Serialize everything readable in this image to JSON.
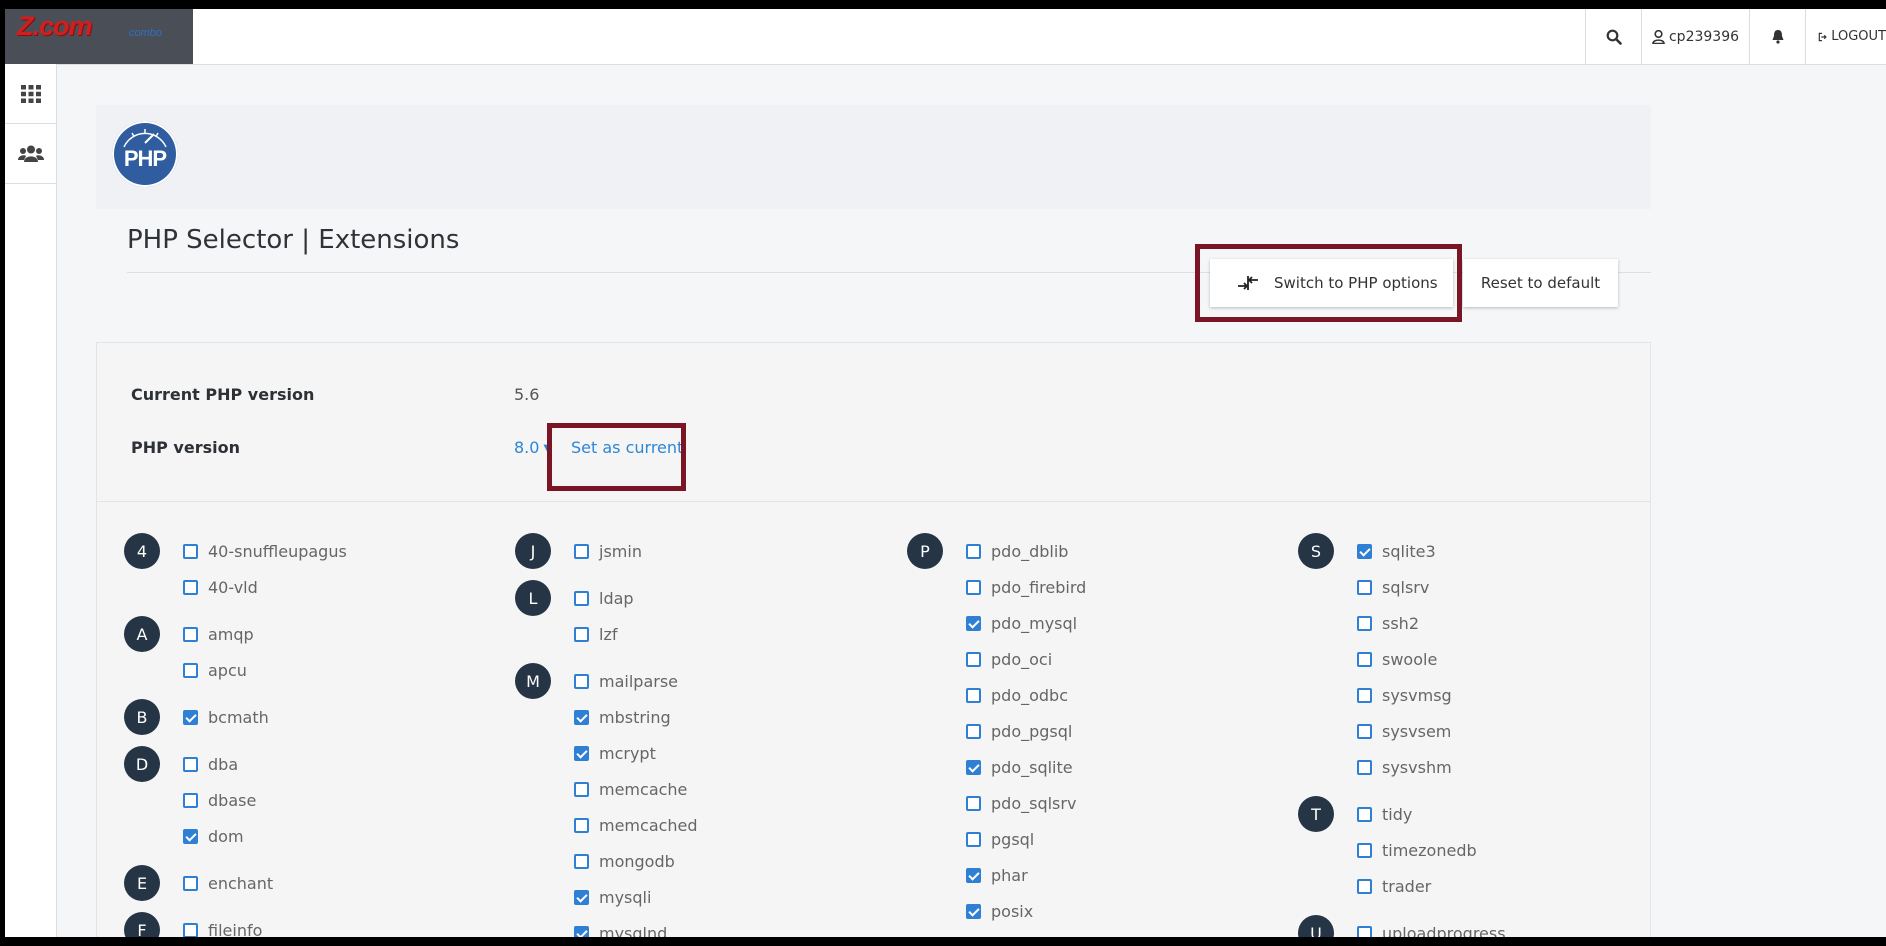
{
  "header": {
    "logo_brand": "Z.com",
    "logo_sub": "combo",
    "username": "cp239396",
    "logout_label": "LOGOUT"
  },
  "rail": {
    "icons": [
      "grid-icon",
      "users-icon"
    ]
  },
  "page": {
    "title": "PHP Selector | Extensions",
    "logo_text": "PHP",
    "switch_label": "Switch to PHP options",
    "reset_label": "Reset to default"
  },
  "version": {
    "current_label": "Current PHP version",
    "current_value": "5.6",
    "php_label": "PHP version",
    "php_value": "8.0",
    "set_current_label": "Set as current"
  },
  "columns": [
    {
      "groups": [
        {
          "letter": "4",
          "items": [
            {
              "name": "40-snuffleupagus",
              "checked": false
            },
            {
              "name": "40-vld",
              "checked": false
            }
          ]
        },
        {
          "letter": "A",
          "items": [
            {
              "name": "amqp",
              "checked": false
            },
            {
              "name": "apcu",
              "checked": false
            }
          ]
        },
        {
          "letter": "B",
          "items": [
            {
              "name": "bcmath",
              "checked": true
            }
          ]
        },
        {
          "letter": "D",
          "items": [
            {
              "name": "dba",
              "checked": false
            },
            {
              "name": "dbase",
              "checked": false
            },
            {
              "name": "dom",
              "checked": true
            }
          ]
        },
        {
          "letter": "E",
          "items": [
            {
              "name": "enchant",
              "checked": false
            }
          ]
        },
        {
          "letter": "F",
          "items": [
            {
              "name": "fileinfo",
              "checked": false
            }
          ]
        }
      ]
    },
    {
      "groups": [
        {
          "letter": "J",
          "items": [
            {
              "name": "jsmin",
              "checked": false
            }
          ]
        },
        {
          "letter": "L",
          "items": [
            {
              "name": "ldap",
              "checked": false
            },
            {
              "name": "lzf",
              "checked": false
            }
          ]
        },
        {
          "letter": "M",
          "items": [
            {
              "name": "mailparse",
              "checked": false
            },
            {
              "name": "mbstring",
              "checked": true
            },
            {
              "name": "mcrypt",
              "checked": true
            },
            {
              "name": "memcache",
              "checked": false
            },
            {
              "name": "memcached",
              "checked": false
            },
            {
              "name": "mongodb",
              "checked": false
            },
            {
              "name": "mysqli",
              "checked": true
            },
            {
              "name": "mysqlnd",
              "checked": true
            }
          ]
        }
      ]
    },
    {
      "groups": [
        {
          "letter": "P",
          "items": [
            {
              "name": "pdo_dblib",
              "checked": false
            },
            {
              "name": "pdo_firebird",
              "checked": false
            },
            {
              "name": "pdo_mysql",
              "checked": true
            },
            {
              "name": "pdo_oci",
              "checked": false
            },
            {
              "name": "pdo_odbc",
              "checked": false
            },
            {
              "name": "pdo_pgsql",
              "checked": false
            },
            {
              "name": "pdo_sqlite",
              "checked": true
            },
            {
              "name": "pdo_sqlsrv",
              "checked": false
            },
            {
              "name": "pgsql",
              "checked": false
            },
            {
              "name": "phar",
              "checked": true
            },
            {
              "name": "posix",
              "checked": true
            }
          ]
        }
      ]
    },
    {
      "groups": [
        {
          "letter": "S",
          "items": [
            {
              "name": "sqlite3",
              "checked": true
            },
            {
              "name": "sqlsrv",
              "checked": false
            },
            {
              "name": "ssh2",
              "checked": false
            },
            {
              "name": "swoole",
              "checked": false
            },
            {
              "name": "sysvmsg",
              "checked": false
            },
            {
              "name": "sysvsem",
              "checked": false
            },
            {
              "name": "sysvshm",
              "checked": false
            }
          ]
        },
        {
          "letter": "T",
          "items": [
            {
              "name": "tidy",
              "checked": false
            },
            {
              "name": "timezonedb",
              "checked": false
            },
            {
              "name": "trader",
              "checked": false
            }
          ]
        },
        {
          "letter": "U",
          "items": [
            {
              "name": "uploadprogress",
              "checked": false
            }
          ]
        }
      ]
    }
  ]
}
